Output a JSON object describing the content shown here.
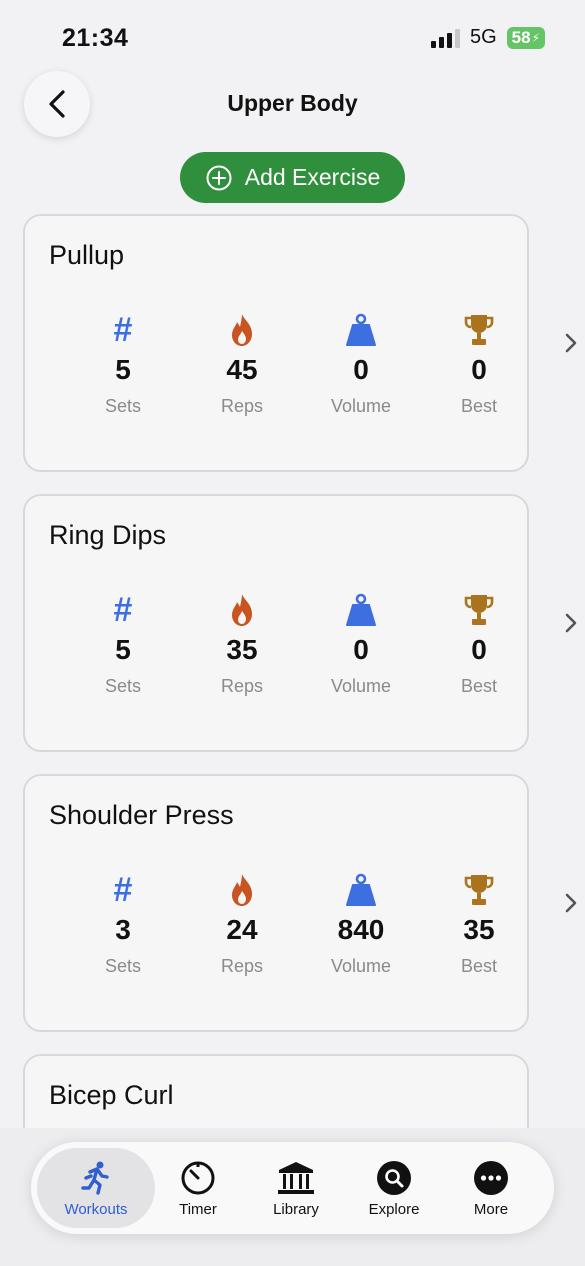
{
  "status_bar": {
    "time": "21:34",
    "network": "5G",
    "battery": "58"
  },
  "header": {
    "title": "Upper Body"
  },
  "add_button": {
    "label": "Add Exercise"
  },
  "stat_labels": {
    "sets": "Sets",
    "reps": "Reps",
    "volume": "Volume",
    "best": "Best"
  },
  "exercises": [
    {
      "name": "Pullup",
      "sets": "5",
      "reps": "45",
      "volume": "0",
      "best": "0"
    },
    {
      "name": "Ring Dips",
      "sets": "5",
      "reps": "35",
      "volume": "0",
      "best": "0"
    },
    {
      "name": "Shoulder Press",
      "sets": "3",
      "reps": "24",
      "volume": "840",
      "best": "35"
    },
    {
      "name": "Bicep Curl"
    }
  ],
  "tabs": [
    {
      "label": "Workouts",
      "icon": "running-person-icon",
      "active": true
    },
    {
      "label": "Timer",
      "icon": "timer-icon"
    },
    {
      "label": "Library",
      "icon": "library-icon"
    },
    {
      "label": "Explore",
      "icon": "search-icon"
    },
    {
      "label": "More",
      "icon": "more-icon"
    }
  ],
  "colors": {
    "accent_green": "#2f8f3c",
    "sets_blue": "#3d6fe0",
    "reps_orange": "#c8541f",
    "volume_blue": "#3d6fe0",
    "best_gold": "#a9741d",
    "active_tab": "#2f5fd0"
  }
}
